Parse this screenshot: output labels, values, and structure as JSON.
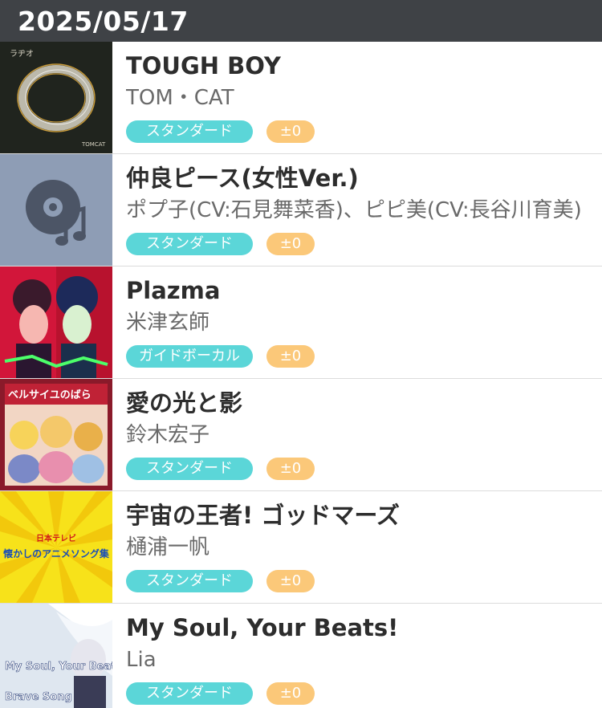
{
  "header": {
    "date": "2025/05/17"
  },
  "songs": [
    {
      "title": "TOUGH BOY",
      "artist": "TOM・CAT",
      "type": "スタンダード",
      "key": "±0",
      "art_text": "ラヂオ",
      "art_text2": "TOMCAT"
    },
    {
      "title": "仲良ピース(女性Ver.)",
      "artist": "ポプ子(CV:石見舞菜香)、ピピ美(CV:長谷川育美)",
      "type": "スタンダード",
      "key": "±0"
    },
    {
      "title": "Plazma",
      "artist": "米津玄師",
      "type": "ガイドボーカル",
      "key": "±0"
    },
    {
      "title": "愛の光と影",
      "artist": "鈴木宏子",
      "type": "スタンダード",
      "key": "±0",
      "art_text": "ベルサイユのばら"
    },
    {
      "title": "宇宙の王者! ゴッドマーズ",
      "artist": "樋浦一帆",
      "type": "スタンダード",
      "key": "±0",
      "art_text": "日本テレビ",
      "art_text2": "懐かしのアニメソング集"
    },
    {
      "title": "My Soul,  Your Beats!",
      "artist": "Lia",
      "type": "スタンダード",
      "key": "±0",
      "art_text": "My Soul, Your Beats!",
      "art_text2": "Brave Song"
    }
  ],
  "colors": {
    "header_bg": "#3f4246",
    "type_badge": "#5bd6d8",
    "key_badge": "#fbc879",
    "placeholder_art_bg": "#8e9db5"
  },
  "icons": {
    "placeholder_art": "music-disc-icon"
  }
}
